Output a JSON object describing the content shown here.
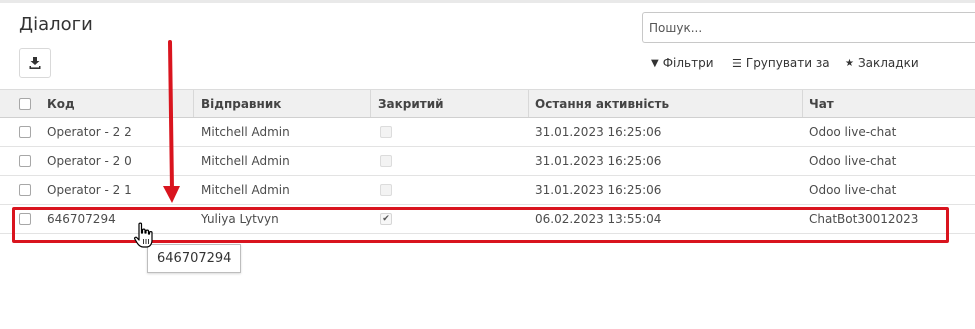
{
  "page": {
    "title": "Діалоги"
  },
  "search": {
    "placeholder": "Пошук..."
  },
  "toolbar": {
    "filters": "Фільтри",
    "group_by": "Групувати за",
    "favorites": "Закладки"
  },
  "table": {
    "columns": [
      "Код",
      "Відправник",
      "Закритий",
      "Остання активність",
      "Чат"
    ],
    "rows": [
      {
        "code": "Operator - 2 2",
        "sender": "Mitchell Admin",
        "closed": false,
        "last_activity": "31.01.2023 16:25:06",
        "chat": "Odoo live-chat"
      },
      {
        "code": "Operator - 2 0",
        "sender": "Mitchell Admin",
        "closed": false,
        "last_activity": "31.01.2023 16:25:06",
        "chat": "Odoo live-chat"
      },
      {
        "code": "Operator - 2 1",
        "sender": "Mitchell Admin",
        "closed": false,
        "last_activity": "31.01.2023 16:25:06",
        "chat": "Odoo live-chat"
      },
      {
        "code": "646707294",
        "sender": "Yuliya Lytvyn",
        "closed": true,
        "last_activity": "06.02.2023 13:55:04",
        "chat": "ChatBot30012023"
      }
    ]
  },
  "tooltip": {
    "text": "646707294"
  },
  "colors": {
    "annotation": "#d9141e",
    "header_bg": "#f0f0f0"
  },
  "icons": {
    "download": "download-icon",
    "filter": "filter-icon",
    "group": "list-icon",
    "favorites": "star-icon",
    "pointer": "hand-pointer-icon"
  }
}
